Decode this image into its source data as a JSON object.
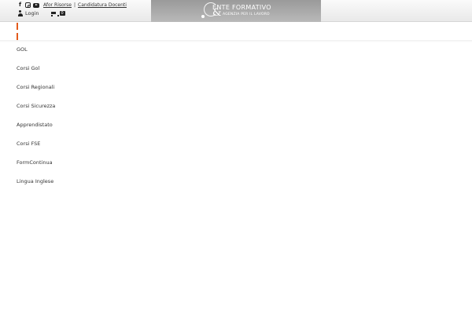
{
  "header": {
    "social_icons": [
      "facebook-icon",
      "instagram-icon",
      "youtube-icon"
    ],
    "links": [
      "Afor Risorse",
      "Candidatura Docenti"
    ],
    "separator": "|",
    "login_label": "Login",
    "cart_count": "0"
  },
  "logo": {
    "title": "ENTE FORMATIVO",
    "ampersand": "&",
    "subtitle": "AGENZIA PER IL LAVORO"
  },
  "menu": {
    "items": [
      "GOL",
      "Corsi Gol",
      "Corsi Regionali",
      "Corsi Sicurezza",
      "Apprendistato",
      "Corsi FSE",
      "FormContinua",
      "Lingua Inglese"
    ]
  },
  "colors": {
    "accent": "#e35a1b",
    "logo_background": "#a8a8a8",
    "topbar_background": "#f2f2f2"
  }
}
